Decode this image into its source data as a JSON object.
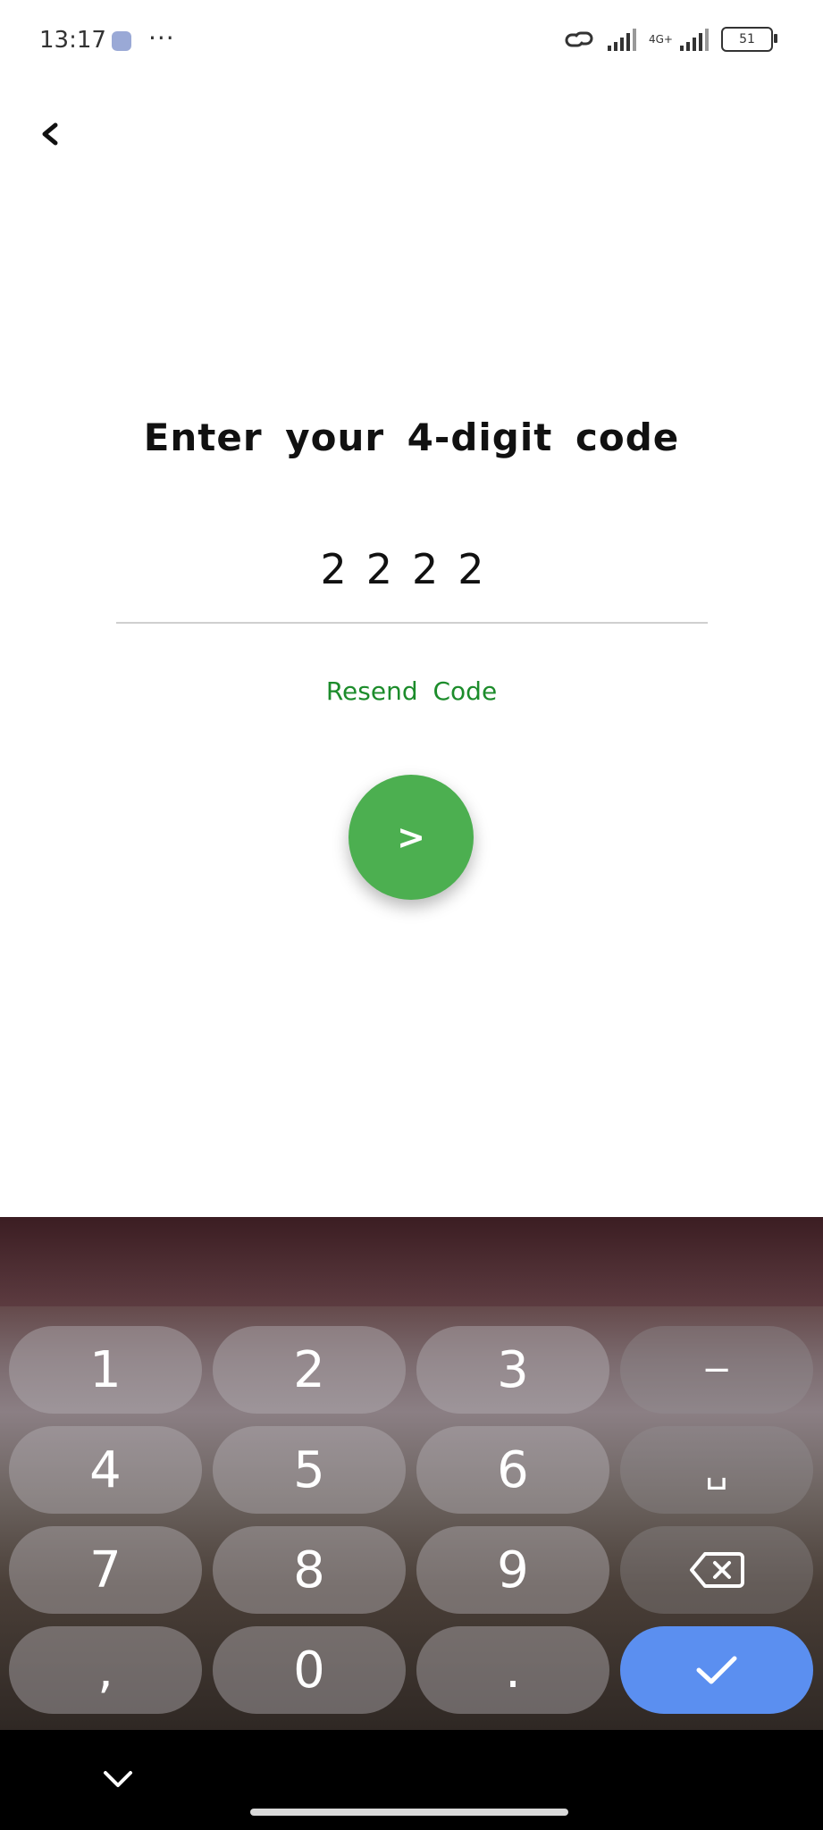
{
  "status_bar": {
    "time": "13:17",
    "more": "···",
    "network_type": "4G+",
    "battery_level": "51"
  },
  "title": "Enter your 4-digit code",
  "code_input": {
    "value": "2222"
  },
  "resend_label": "Resend Code",
  "next_button_label": ">",
  "keyboard": {
    "keys": {
      "k1": "1",
      "k2": "2",
      "k3": "3",
      "dash": "−",
      "k4": "4",
      "k5": "5",
      "k6": "6",
      "space": "␣",
      "k7": "7",
      "k8": "8",
      "k9": "9",
      "comma": ",",
      "k0": "0",
      "dot": "."
    },
    "confirm_color": "#5b8ff0"
  },
  "colors": {
    "accent_green": "#4caf50",
    "resend_green": "#1c8c2b"
  }
}
